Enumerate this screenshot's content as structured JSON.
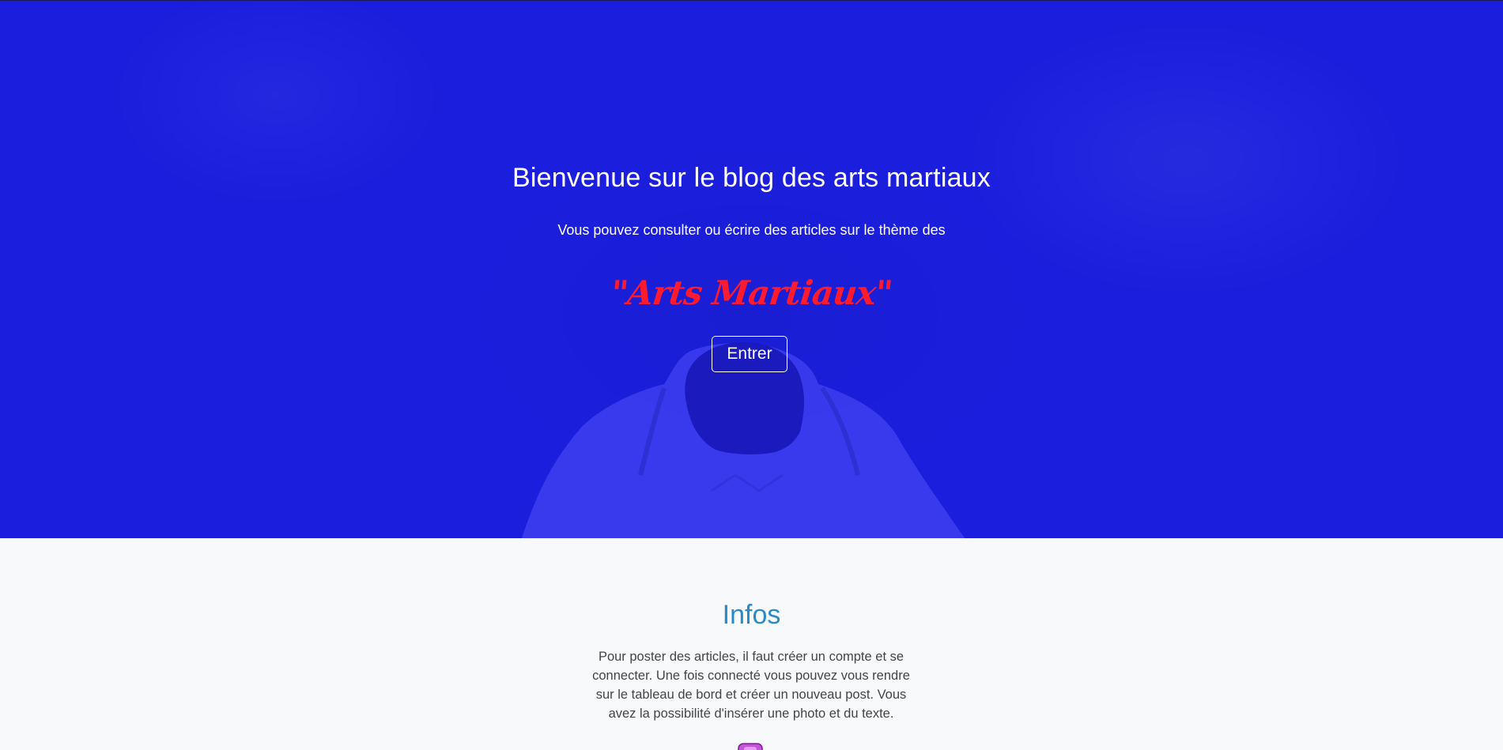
{
  "hero": {
    "title": "Bienvenue sur le blog des arts martiaux",
    "subtitle": "Vous pouvez consulter ou écrire des articles sur le thème des",
    "highlight": "\"Arts Martiaux\"",
    "enter_label": "Entrer"
  },
  "infos": {
    "title": "Infos",
    "text": "Pour poster des articles, il faut créer un compte et se connecter. Une fois connecté vous pouvez vous rendre sur le tableau de bord et créer un nouveau post. Vous avez la possibilité d'insérer une photo et du texte."
  },
  "icons": {
    "hero_figure": "martial-artist-silhouette",
    "infos_icon": "purple-badge-icon"
  },
  "colors": {
    "hero_background": "#1b1fdd",
    "highlight": "#ff1a2e",
    "infos_title": "#2a8ac8",
    "page_background": "#f8f9fb"
  }
}
